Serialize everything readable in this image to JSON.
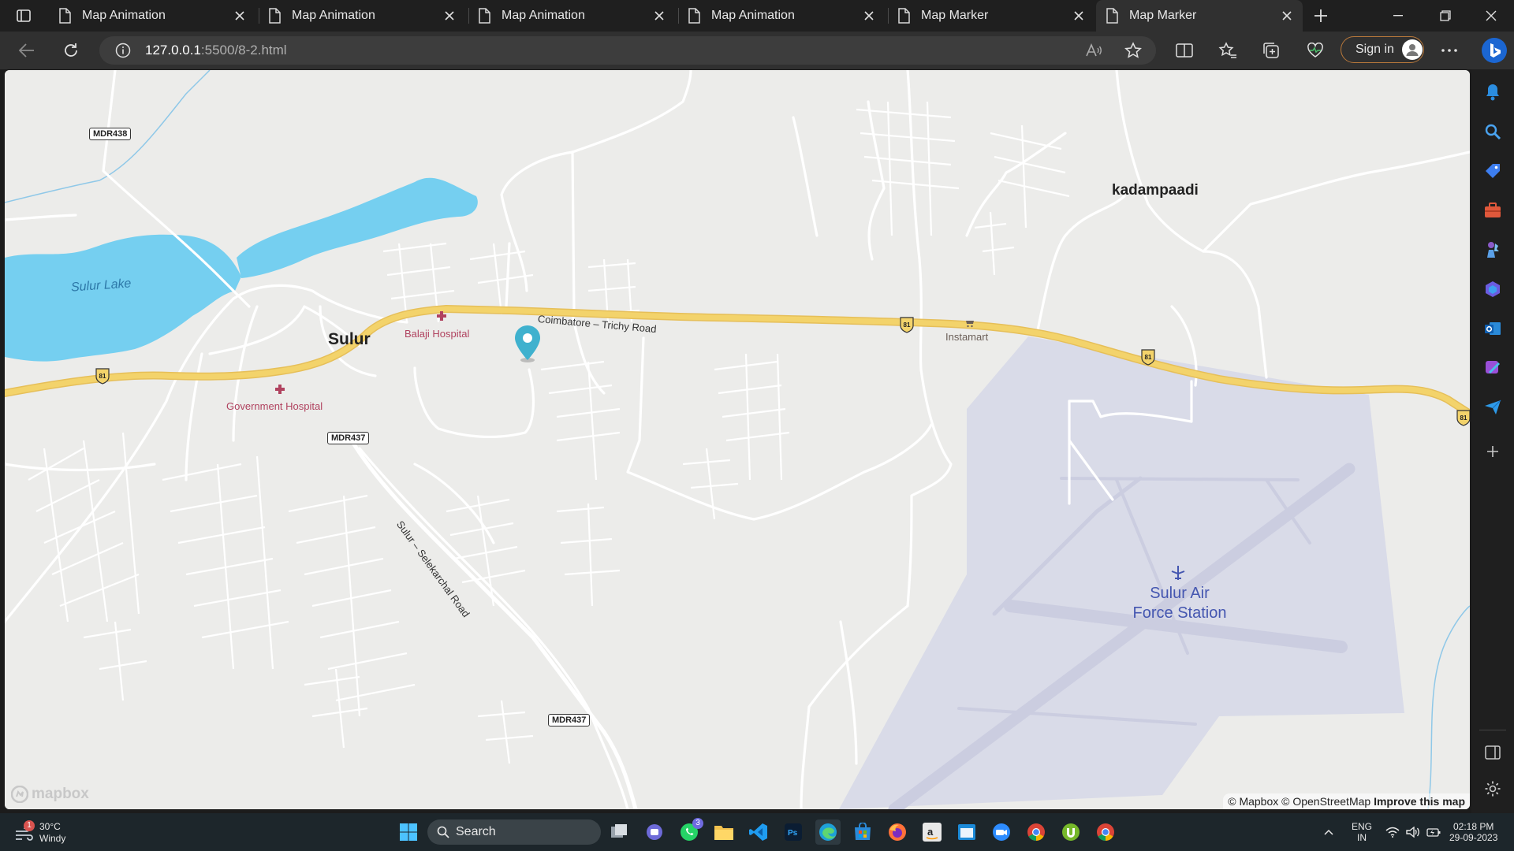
{
  "browser": {
    "tabs": [
      {
        "title": "Map Animation",
        "active": false
      },
      {
        "title": "Map Animation",
        "active": false
      },
      {
        "title": "Map Animation",
        "active": false
      },
      {
        "title": "Map Animation",
        "active": false
      },
      {
        "title": "Map Marker",
        "active": false
      },
      {
        "title": "Map Marker",
        "active": true
      }
    ],
    "address": {
      "host": "127.0.0.1",
      "path": ":5500/8-2.html"
    },
    "signin_label": "Sign in",
    "accent_color": "#b8783b"
  },
  "map": {
    "places": {
      "sulur": "Sulur",
      "kadampaadi": "kadampaadi",
      "air_station_line1": "Sulur Air",
      "air_station_line2": "Force Station"
    },
    "pois": {
      "balaji_hospital": "Balaji Hospital",
      "government_hospital": "Government Hospital",
      "instamart": "Instamart"
    },
    "water": {
      "sulur_lake": "Sulur Lake"
    },
    "roads": {
      "coimbatore_trichy": "Coimbatore – Trichy Road",
      "sulur_selekarchal": "Sulur – Selekarchal Road"
    },
    "shields": {
      "mdr438": "MDR438",
      "mdr437_a": "MDR437",
      "mdr437_b": "MDR437",
      "nh": "81"
    },
    "logo": "mapbox",
    "attribution": {
      "mapbox": "© Mapbox",
      "osm": "© OpenStreetMap",
      "improve": "Improve this map"
    },
    "colors": {
      "land": "#ececea",
      "water": "#75cff0",
      "highway": "#f3d36b",
      "airport": "#d9dbe8",
      "marker": "#3fb1ce"
    }
  },
  "taskbar": {
    "weather": {
      "temp": "30°C",
      "condition": "Windy",
      "badge": "1"
    },
    "search_label": "Search",
    "whatsapp_badge": "3",
    "language": {
      "line1": "ENG",
      "line2": "IN"
    },
    "clock": {
      "time": "02:18 PM",
      "date": "29-09-2023"
    }
  }
}
